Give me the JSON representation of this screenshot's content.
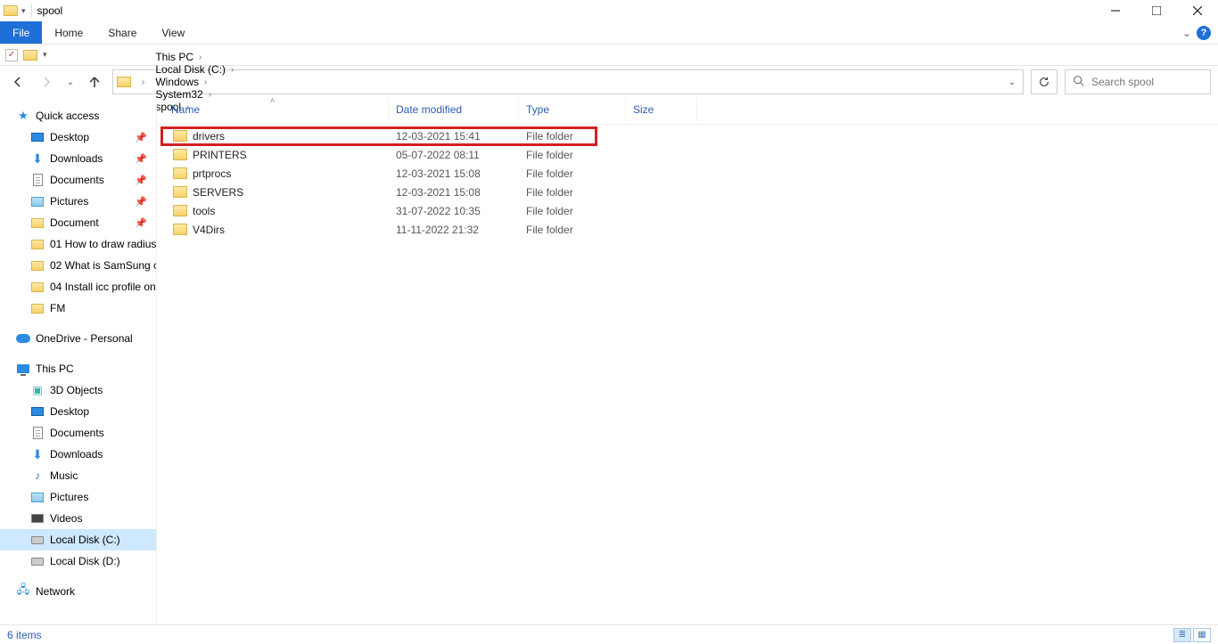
{
  "window": {
    "title": "spool"
  },
  "ribbon": {
    "file": "File",
    "home": "Home",
    "share": "Share",
    "view": "View"
  },
  "breadcrumbs": [
    "This PC",
    "Local Disk (C:)",
    "Windows",
    "System32",
    "spool"
  ],
  "search": {
    "placeholder": "Search spool"
  },
  "columns": {
    "name": "Name",
    "date": "Date modified",
    "type": "Type",
    "size": "Size"
  },
  "rows": [
    {
      "name": "drivers",
      "date": "12-03-2021 15:41",
      "type": "File folder",
      "highlighted": true
    },
    {
      "name": "PRINTERS",
      "date": "05-07-2022 08:11",
      "type": "File folder"
    },
    {
      "name": "prtprocs",
      "date": "12-03-2021 15:08",
      "type": "File folder"
    },
    {
      "name": "SERVERS",
      "date": "12-03-2021 15:08",
      "type": "File folder"
    },
    {
      "name": "tools",
      "date": "31-07-2022 10:35",
      "type": "File folder"
    },
    {
      "name": "V4Dirs",
      "date": "11-11-2022 21:32",
      "type": "File folder"
    }
  ],
  "sidebar": {
    "quick_access": "Quick access",
    "quick_items": [
      {
        "label": "Desktop",
        "icon": "desktop",
        "pinned": true
      },
      {
        "label": "Downloads",
        "icon": "dl",
        "pinned": true
      },
      {
        "label": "Documents",
        "icon": "doc",
        "pinned": true
      },
      {
        "label": "Pictures",
        "icon": "pic",
        "pinned": true
      },
      {
        "label": "Document",
        "icon": "folder",
        "pinned": true
      },
      {
        "label": "01 How to draw radius",
        "icon": "folder"
      },
      {
        "label": "02 What is SamSung cl",
        "icon": "folder"
      },
      {
        "label": "04 Install icc profile on",
        "icon": "folder"
      },
      {
        "label": "FM",
        "icon": "folder"
      }
    ],
    "onedrive": "OneDrive - Personal",
    "thispc": "This PC",
    "pc_items": [
      {
        "label": "3D Objects",
        "icon": "3d"
      },
      {
        "label": "Desktop",
        "icon": "desktop"
      },
      {
        "label": "Documents",
        "icon": "doc"
      },
      {
        "label": "Downloads",
        "icon": "dl"
      },
      {
        "label": "Music",
        "icon": "music"
      },
      {
        "label": "Pictures",
        "icon": "pic"
      },
      {
        "label": "Videos",
        "icon": "video"
      },
      {
        "label": "Local Disk (C:)",
        "icon": "disk",
        "selected": true
      },
      {
        "label": "Local Disk (D:)",
        "icon": "disk"
      }
    ],
    "network": "Network"
  },
  "status": {
    "count": "6 items"
  }
}
